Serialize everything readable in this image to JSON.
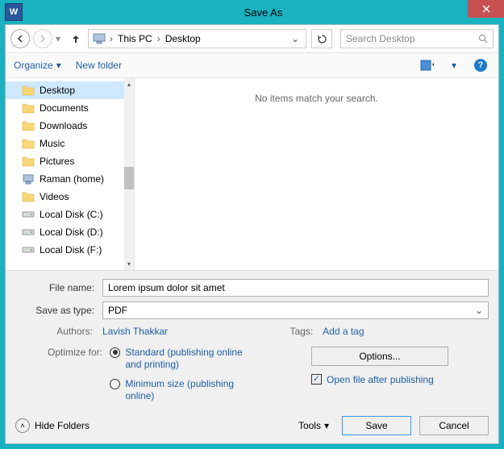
{
  "title": "Save As",
  "app_icon_letter": "W",
  "breadcrumb": {
    "seg1": "This PC",
    "seg2": "Desktop"
  },
  "search": {
    "placeholder": "Search Desktop"
  },
  "toolbar": {
    "organize": "Organize",
    "new_folder": "New folder"
  },
  "sidebar": {
    "items": [
      {
        "label": "Desktop",
        "type": "folder",
        "selected": true
      },
      {
        "label": "Documents",
        "type": "folder"
      },
      {
        "label": "Downloads",
        "type": "folder"
      },
      {
        "label": "Music",
        "type": "folder"
      },
      {
        "label": "Pictures",
        "type": "folder"
      },
      {
        "label": "Raman (home)",
        "type": "pc"
      },
      {
        "label": "Videos",
        "type": "folder"
      },
      {
        "label": "Local Disk (C:)",
        "type": "drive"
      },
      {
        "label": "Local Disk (D:)",
        "type": "drive"
      },
      {
        "label": "Local Disk (F:)",
        "type": "drive"
      }
    ]
  },
  "main": {
    "empty_text": "No items match your search."
  },
  "form": {
    "file_name_label": "File name:",
    "file_name_value": "Lorem ipsum dolor sit amet",
    "save_type_label": "Save as type:",
    "save_type_value": "PDF",
    "authors_label": "Authors:",
    "authors_value": "Lavish Thakkar",
    "tags_label": "Tags:",
    "tags_value": "Add a tag",
    "optimize_label": "Optimize for:",
    "radio_standard": "Standard (publishing online and printing)",
    "radio_minimum": "Minimum size (publishing online)",
    "options_button": "Options...",
    "open_after": "Open file after publishing"
  },
  "footer": {
    "hide_folders": "Hide Folders",
    "tools": "Tools",
    "save": "Save",
    "cancel": "Cancel"
  }
}
